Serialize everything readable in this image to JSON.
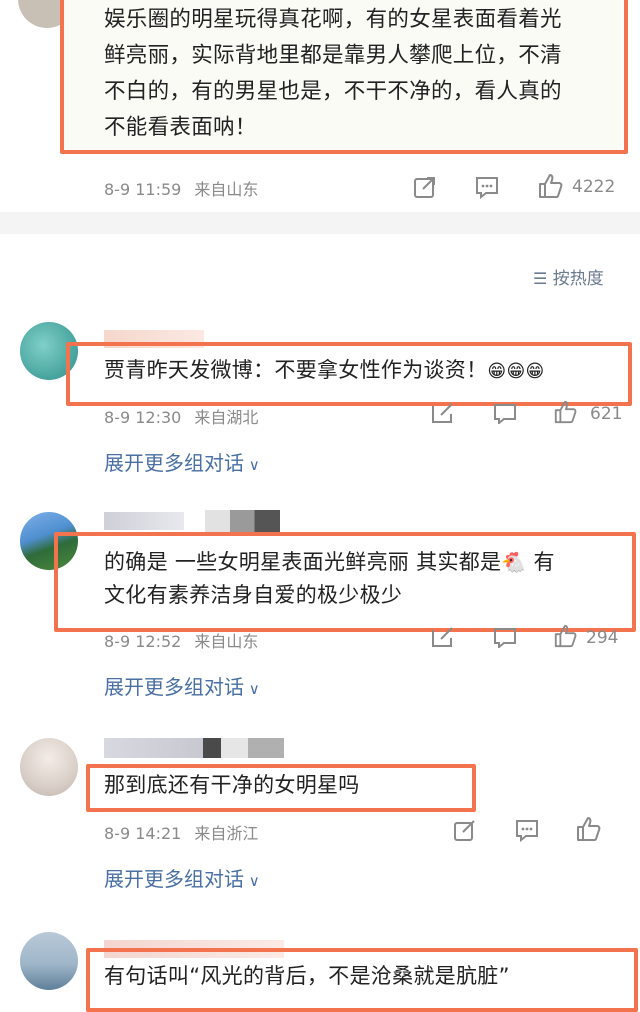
{
  "sort": {
    "label": "按热度"
  },
  "emoji": {
    "grin": "😁😁😁",
    "chicken": "🐔"
  },
  "comments": [
    {
      "lines": [
        "娱乐圈的明星玩得真花啊，有的女星表面看着光",
        "鲜亮丽，实际背地里都是靠男人攀爬上位，不清",
        "不白的，有的男星也是，不干不净的，看人真的",
        "不能看表面呐！"
      ],
      "time": "8-9 11:59",
      "location": "来自山东",
      "likes": "4222"
    },
    {
      "text": "贾青昨天发微博：不要拿女性作为谈资！",
      "time": "8-9 12:30",
      "location": "来自湖北",
      "likes": "621",
      "expand": "展开更多组对话"
    },
    {
      "line1": "的确是 一些女明星表面光鲜亮丽 其实都是",
      "line1_end": "有",
      "line2": "文化有素养洁身自爱的极少极少",
      "time": "8-9 12:52",
      "location": "来自山东",
      "likes": "294",
      "expand": "展开更多组对话"
    },
    {
      "text": "那到底还有干净的女明星吗",
      "time": "8-9 14:21",
      "location": "来自浙江",
      "expand": "展开更多组对话"
    },
    {
      "text": "有句话叫“风光的背后，不是沧桑就是肮脏”"
    }
  ],
  "colors": {
    "highlight": "#f2734d",
    "link": "#4a6fa5",
    "meta": "#8a8a8a"
  }
}
